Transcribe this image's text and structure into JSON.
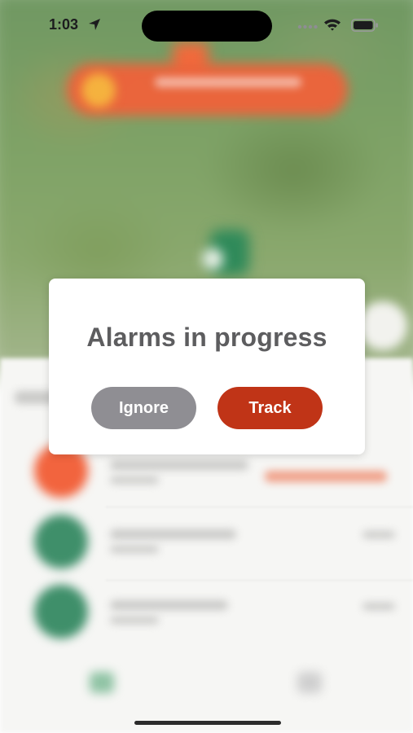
{
  "status_bar": {
    "time": "1:03"
  },
  "dialog": {
    "title": "Alarms in progress",
    "ignore_label": "Ignore",
    "track_label": "Track"
  },
  "colors": {
    "track_button": "#c03417",
    "ignore_button": "#8f8e93",
    "title_text": "#5d5d5f"
  },
  "icons": {
    "location": "navigation-arrow-icon",
    "signal": "cellular-signal-icon",
    "wifi": "wifi-icon",
    "battery": "battery-icon"
  }
}
